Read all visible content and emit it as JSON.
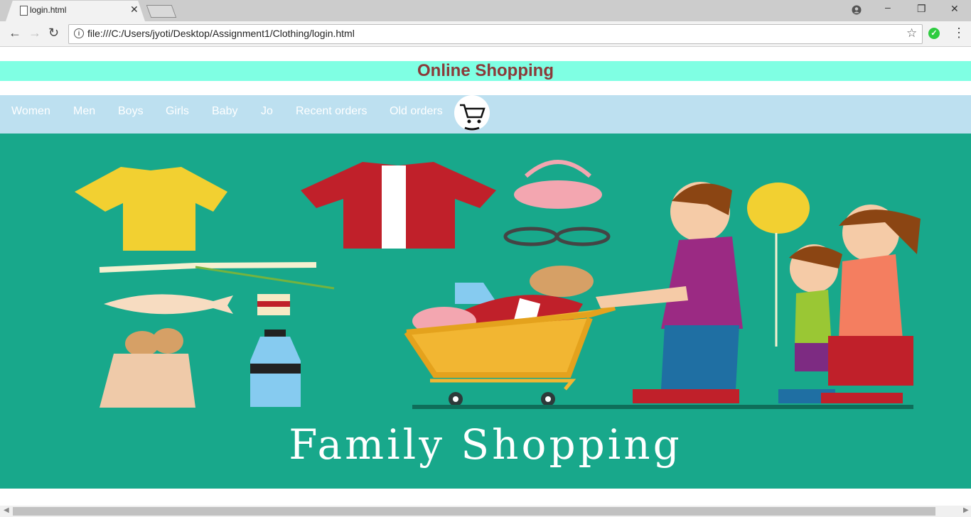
{
  "browser": {
    "tab_title": "login.html",
    "url": "file:///C:/Users/jyoti/Desktop/Assignment1/Clothing/login.html"
  },
  "page": {
    "title": "Online Shopping",
    "nav_items": [
      "Women",
      "Men",
      "Boys",
      "Girls",
      "Baby",
      "Jo",
      "Recent orders",
      "Old orders"
    ],
    "hero_caption": "Family Shopping"
  },
  "colors": {
    "banner_bg": "#7fffe3",
    "title_color": "#8b3a3a",
    "nav_bg": "#bde0f0",
    "hero_bg": "#18a88b"
  },
  "icons": [
    "file-icon",
    "close-icon",
    "account-icon",
    "minimize-icon",
    "restore-icon",
    "back-icon",
    "forward-icon",
    "reload-icon",
    "info-icon",
    "star-icon",
    "extension-check-icon",
    "menu-icon",
    "cart-icon"
  ]
}
